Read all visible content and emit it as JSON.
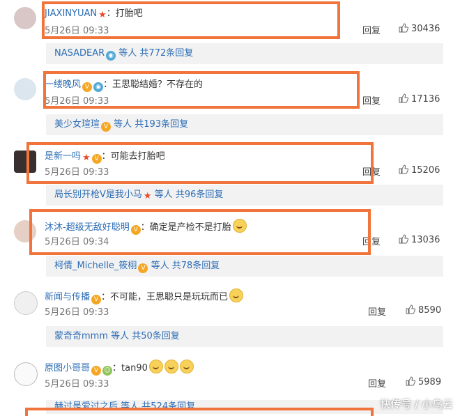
{
  "reply_label": "回复",
  "comments": [
    {
      "user": "JIAXINYUAN",
      "text": "：打胎吧",
      "time": "5月26日 09:33",
      "likes": "30436",
      "sub_user": "NASADEAR",
      "sub_rest": " 等人 共772条回复"
    },
    {
      "user": "一缕晚风",
      "text": "：王思聪结婚？不存在的",
      "time": "5月26日 09:33",
      "likes": "17136",
      "sub_user": "美少女瑄瑄",
      "sub_rest": " 等人 共193条回复"
    },
    {
      "user": "是新一吗",
      "text": "：可能去打胎吧",
      "time": "5月26日 09:33",
      "likes": "15206",
      "sub_user": "局长别开枪V是我小马",
      "sub_rest": " 等人 共96条回复"
    },
    {
      "user": "沐沐-超级无敌好聪明",
      "text": "：确定是产检不是打胎",
      "time": "5月26日 09:34",
      "likes": "13036",
      "sub_user": "柯倩_Michelle_筱栩",
      "sub_rest": " 等人 共78条回复"
    },
    {
      "user": "新闻与传播",
      "text": "：不可能，王思聪只是玩玩而已",
      "time": "5月26日 09:33",
      "likes": "8590",
      "sub_user": "蒙奇奇mmm",
      "sub_rest": " 等人 共50条回复"
    },
    {
      "user": "原图小哥哥",
      "text": "：tan90",
      "time": "5月26日 09:33",
      "likes": "5989",
      "sub_user": "赫过是爱过之后",
      "sub_rest": " 等人 共524条回复"
    }
  ],
  "watermark": "快传号 / 小鸟云",
  "colors": {
    "highlight": "#f0743b",
    "link": "#2d6db5",
    "subbox_bg": "#f2f2f2"
  }
}
